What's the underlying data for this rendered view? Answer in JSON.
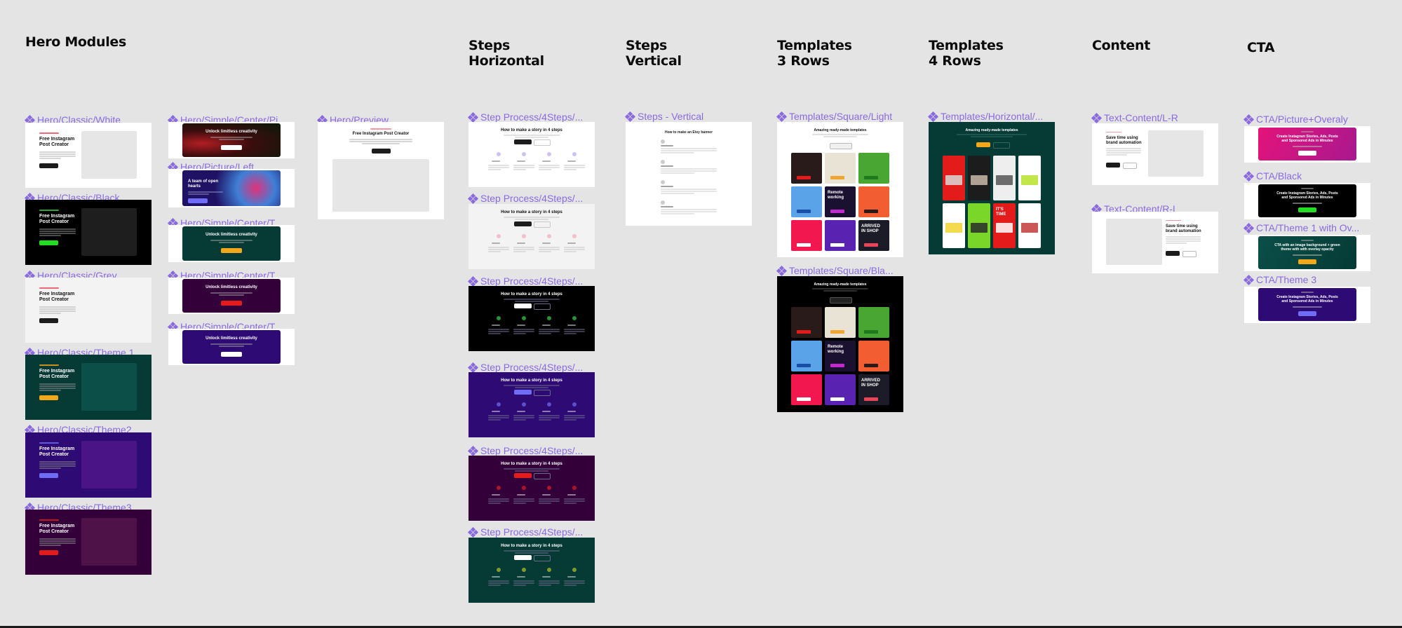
{
  "canvas": {
    "background": "#e4e4e4",
    "label_color": "#8a6ae0"
  },
  "sections": [
    {
      "id": "hero",
      "title": "Hero Modules"
    },
    {
      "id": "steps-h",
      "title": "Steps\nHorizontal"
    },
    {
      "id": "steps-v",
      "title": "Steps\nVertical"
    },
    {
      "id": "tpl3",
      "title": "Templates\n3 Rows"
    },
    {
      "id": "tpl4",
      "title": "Templates\n4 Rows"
    },
    {
      "id": "content",
      "title": "Content"
    },
    {
      "id": "cta",
      "title": "CTA"
    }
  ],
  "components": {
    "hero_classic": [
      {
        "label": "Hero/Classic/White",
        "bg": "#ffffff",
        "media": "#e6e6e6",
        "text": "#111111",
        "eyebrow": "#e8455a",
        "button": "#1c1c1c",
        "heading": "Free Instagram\nPost Creator"
      },
      {
        "label": "Hero/Classic/Black",
        "bg": "#000000",
        "media": "#1e1e1e",
        "text": "#ffffff",
        "eyebrow": "#35d14a",
        "button": "#22dd22",
        "heading": "Free Instagram\nPost Creator"
      },
      {
        "label": "Hero/Classic/Grey",
        "bg": "#f3f3f3",
        "media": "#f3f3f3",
        "text": "#111111",
        "eyebrow": "#e8455a",
        "button": "#1c1c1c",
        "heading": "Free Instagram\nPost Creator"
      },
      {
        "label": "Hero/Classic/Theme 1",
        "bg": "#063a35",
        "media": "#0c4f48",
        "text": "#ffffff",
        "eyebrow": "#f3a81c",
        "button": "#f3a81c",
        "heading": "Free Instagram\nPost Creator"
      },
      {
        "label": "Hero/Classic/Theme2",
        "bg": "#2e0a74",
        "media": "#4a1486",
        "text": "#ffffff",
        "eyebrow": "#6f6cf5",
        "button": "#6f6cf5",
        "heading": "Free Instagram\nPost Creator"
      },
      {
        "label": "Hero/Classic/Theme3",
        "bg": "#33003a",
        "media": "#4e1249",
        "text": "#ffffff",
        "eyebrow": "#e31b1b",
        "button": "#e31b1b",
        "heading": "Free Instagram\nPost Creator"
      }
    ],
    "hero_simple": [
      {
        "label": "Hero/Simple/Center/Pi...",
        "bg": "#3a0d0d",
        "accent": "#b11d24",
        "heading": "Unlock limitless creativity",
        "button": "#ffffff",
        "type": "center"
      },
      {
        "label": "Hero/Picture/Left",
        "bg": "#1f1163",
        "accent": "#e0337a",
        "heading": "A team of open\nhearts",
        "button": "#6f6cf5",
        "type": "left"
      },
      {
        "label": "Hero/Simple/Center/T...",
        "bg": "#063a35",
        "accent": "#063a35",
        "heading": "Unlock limitless creativity",
        "button": "#f3a81c",
        "type": "center"
      },
      {
        "label": "Hero/Simple/Center/T...",
        "bg": "#33003a",
        "accent": "#33003a",
        "heading": "Unlock limitless creativity",
        "button": "#e31b1b",
        "type": "center"
      },
      {
        "label": "Hero/Simple/Center/T...",
        "bg": "#2e0a74",
        "accent": "#2e0a74",
        "heading": "Unlock limitless creativity",
        "button": "#ffffff",
        "type": "center"
      }
    ],
    "hero_preview": {
      "label": "Hero/Preview",
      "heading": "Free Instagram Post Creator",
      "button": "#1c1c1c"
    },
    "steps_horizontal": [
      {
        "label": "Step Process/4Steps/...",
        "bg": "#ffffff",
        "text": "#111111",
        "icon": "#b9a7f2",
        "button": "#1c1c1c",
        "heading": "How to make a story in 4 steps"
      },
      {
        "label": "Step Process/4Steps/...",
        "bg": "#f3f3f3",
        "text": "#111111",
        "icon": "#f2a9b6",
        "button": "#1c1c1c",
        "heading": "How to make a story in 4 steps"
      },
      {
        "label": "Step Process/4Steps/...",
        "bg": "#000000",
        "text": "#ffffff",
        "icon": "#35d14a",
        "button": "#ffffff",
        "heading": "How to make a story in 4 steps"
      },
      {
        "label": "Step Process/4Steps/...",
        "bg": "#2e0a74",
        "text": "#ffffff",
        "icon": "#6f6cf5",
        "button": "#6f6cf5",
        "heading": "How to make a story in 4 steps"
      },
      {
        "label": "Step Process/4Steps/...",
        "bg": "#33003a",
        "text": "#ffffff",
        "icon": "#e31b1b",
        "button": "#e31b1b",
        "heading": "How to make a story in 4 steps"
      },
      {
        "label": "Step Process/4Steps/...",
        "bg": "#063a35",
        "text": "#ffffff",
        "icon": "#b8c230",
        "button": "#ffffff",
        "heading": "How to make a story in 4 steps"
      }
    ],
    "steps_vertical": {
      "label": "Steps - Vertical",
      "heading": "How to make an Etsy banner"
    },
    "templates_3rows": [
      {
        "label": "Templates/Square/Light",
        "bg": "#ffffff",
        "text": "#111111",
        "heading": "Amazing ready-made templates"
      },
      {
        "label": "Templates/Square/Bla...",
        "bg": "#000000",
        "text": "#ffffff",
        "heading": "Amazing ready-made templates"
      }
    ],
    "templates_4rows": {
      "label": "Templates/Horizontal/...",
      "bg": "#063a35",
      "heading": "Amazing ready-made templates",
      "button": "#f3a81c"
    },
    "content": [
      {
        "label": "Text-Content/L-R",
        "heading": "Save time using\nbrand automation",
        "order": "text-left"
      },
      {
        "label": "Text-Content/R-L",
        "heading": "Save time using\nbrand automation",
        "order": "text-right"
      }
    ],
    "cta": [
      {
        "label": "CTA/Picture+Overaly",
        "bg": "#e3147a",
        "accent": "#a8188e",
        "heading": "Create Instagram Stories, Ads, Posts\nand Sponsored Ads in Minutes",
        "button": "#ffffff"
      },
      {
        "label": "CTA/Black",
        "bg": "#000000",
        "accent": "#000000",
        "heading": "Create Instagram Stories, Ads, Posts\nand Sponsored Ads in Minutes",
        "button": "#22dd22"
      },
      {
        "label": "CTA/Theme 1 with Ov...",
        "bg": "#0a4f48",
        "accent": "#063a35",
        "heading": "CTA with an image background + green\ntheme with with overlay opacity",
        "button": "#f3a81c"
      },
      {
        "label": "CTA/Theme 3",
        "bg": "#2e0a74",
        "accent": "#2e0a74",
        "heading": "Create Instagram Stories, Ads, Posts\nand Sponsored Ads in Minutes",
        "button": "#6f6cf5"
      }
    ]
  },
  "template_tiles_square": [
    {
      "bg": "#2a1b1b",
      "accent": "#e31b1b"
    },
    {
      "bg": "#e9e3d6",
      "accent": "#f0a530"
    },
    {
      "bg": "#49a632",
      "accent": "#1f7a1f"
    },
    {
      "bg": "#5aa3e8",
      "accent": "#1a4fa8"
    },
    {
      "bg": "#1a1030",
      "accent": "#c22ad0",
      "text": "Remote\nworking"
    },
    {
      "bg": "#f25d32",
      "accent": "#2a1a1a"
    },
    {
      "bg": "#f2184f",
      "accent": "#ffffff"
    },
    {
      "bg": "#5a22b0",
      "accent": "#ffffff"
    },
    {
      "bg": "#1c1c28",
      "accent": "#e8455a",
      "text": "ARRIVED\nIN SHOP"
    }
  ],
  "template_tiles_vertical": [
    {
      "bg": "#e31b1b",
      "accent": "#d9d9d9"
    },
    {
      "bg": "#1c1c1c",
      "accent": "#c9b8a8"
    },
    {
      "bg": "#eeeeee",
      "accent": "#555555"
    },
    {
      "bg": "#ffffff",
      "accent": "#b7e02a"
    },
    {
      "bg": "#ffffff",
      "accent": "#f2d330"
    },
    {
      "bg": "#7bd62a",
      "accent": "#2a2a2a"
    },
    {
      "bg": "#e31b1b",
      "accent": "#ffffff",
      "text": "IT'S\nTIME"
    },
    {
      "bg": "#ffffff",
      "accent": "#c23a3a"
    }
  ]
}
